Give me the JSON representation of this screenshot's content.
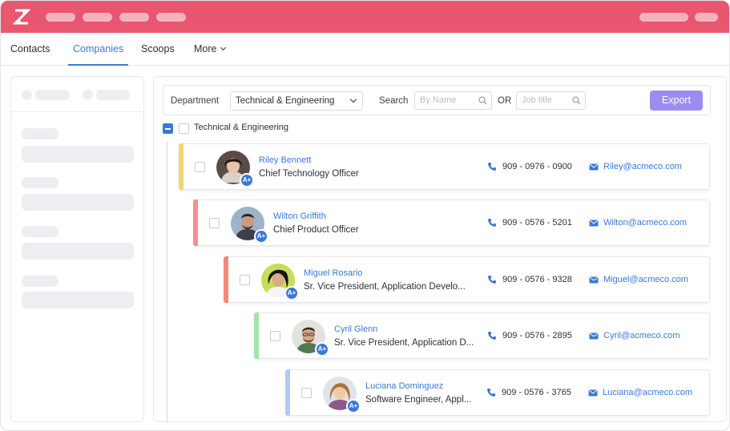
{
  "tabs": [
    {
      "label": "Contacts"
    },
    {
      "label": "Companies"
    },
    {
      "label": "Scoops"
    },
    {
      "label": "More"
    }
  ],
  "filters": {
    "department_label": "Department",
    "department_value": "Technical & Engineering",
    "search_label": "Search",
    "name_placeholder": "By Name",
    "or_label": "OR",
    "title_placeholder": "Job title",
    "export_label": "Export"
  },
  "group": {
    "label": "Technical & Engineering"
  },
  "badge_label": "A+",
  "contacts": [
    {
      "name": "Riley Bennett",
      "title": "Chief Technology Officer",
      "phone": "909 - 0976 - 0900",
      "email": "Riley@acmeco.com",
      "accent": "#f2d675"
    },
    {
      "name": "Wilton Griffith",
      "title": "Chief Product Officer",
      "phone": "909 - 0576 - 5201",
      "email": "Wilton@acmeco.com",
      "accent": "#f58e98"
    },
    {
      "name": "Miguel Rosario",
      "title": "Sr. Vice President, Application Develo...",
      "phone": "909 - 0576 - 9328",
      "email": "Miguel@acmeco.com",
      "accent": "#f7877a"
    },
    {
      "name": "Cyril Glenn",
      "title": "Sr. Vice President, Application D...",
      "phone": "909 - 0576 - 2895",
      "email": "Cyril@acmeco.com",
      "accent": "#a5e3a8"
    },
    {
      "name": "Luciana Dominguez",
      "title": "Software Engineer, Appl...",
      "phone": "909 - 0576 - 3765",
      "email": "Luciana@acmeco.com",
      "accent": "#b4c8f2"
    }
  ],
  "colors": {
    "brand": "#e9566f",
    "accent": "#3a78d6",
    "export": "#9b8cf0"
  },
  "icons": [
    "logo-icon",
    "chevron-down-icon",
    "search-icon",
    "phone-icon",
    "mail-icon"
  ]
}
